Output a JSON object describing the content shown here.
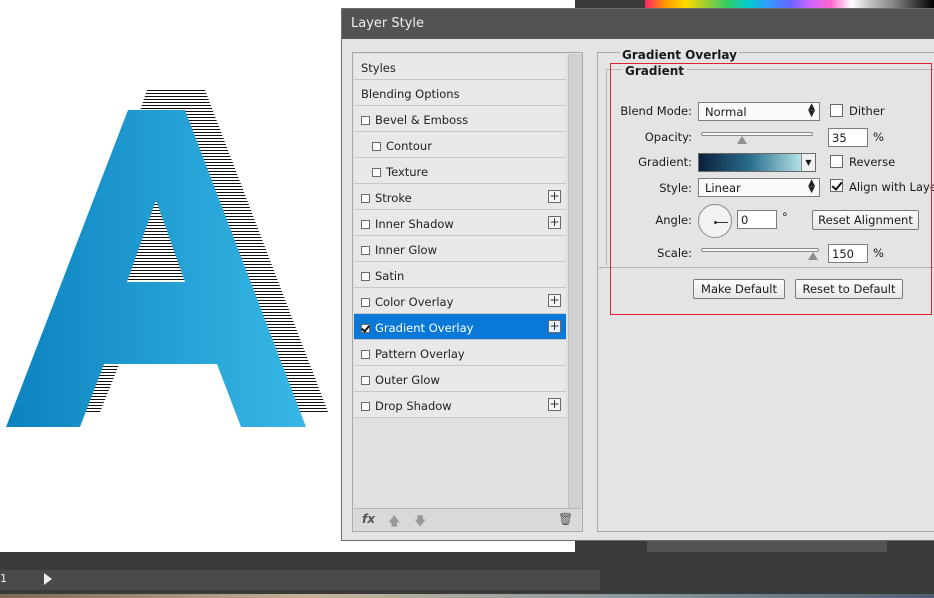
{
  "colors": {
    "accent_selected": "#0a78d7",
    "annotation_red": "#e0202e",
    "letter_gradient_start": "#0c82bf",
    "letter_gradient_end": "#38b8e6"
  },
  "canvas": {
    "letter": "A",
    "status_number": "1"
  },
  "dialog": {
    "title": "Layer Style",
    "styles": [
      {
        "label": "Styles",
        "checkbox": false,
        "plus": false
      },
      {
        "label": "Blending Options",
        "checkbox": false,
        "plus": false
      },
      {
        "label": "Bevel & Emboss",
        "checkbox": true,
        "checked": false,
        "plus": false
      },
      {
        "label": "Contour",
        "checkbox": true,
        "checked": false,
        "plus": false,
        "indent": true
      },
      {
        "label": "Texture",
        "checkbox": true,
        "checked": false,
        "plus": false,
        "indent": true
      },
      {
        "label": "Stroke",
        "checkbox": true,
        "checked": false,
        "plus": true
      },
      {
        "label": "Inner Shadow",
        "checkbox": true,
        "checked": false,
        "plus": true
      },
      {
        "label": "Inner Glow",
        "checkbox": true,
        "checked": false,
        "plus": false
      },
      {
        "label": "Satin",
        "checkbox": true,
        "checked": false,
        "plus": false
      },
      {
        "label": "Color Overlay",
        "checkbox": true,
        "checked": false,
        "plus": true
      },
      {
        "label": "Gradient Overlay",
        "checkbox": true,
        "checked": true,
        "plus": true,
        "selected": true
      },
      {
        "label": "Pattern Overlay",
        "checkbox": true,
        "checked": false,
        "plus": false
      },
      {
        "label": "Outer Glow",
        "checkbox": true,
        "checked": false,
        "plus": false
      },
      {
        "label": "Drop Shadow",
        "checkbox": true,
        "checked": false,
        "plus": true
      }
    ],
    "footer_icons": [
      "fx-icon",
      "move-up-icon",
      "move-down-icon",
      "trash-icon"
    ],
    "fx_label": "fx",
    "panel": {
      "section_title": "Gradient Overlay",
      "group_title": "Gradient",
      "blend_mode": {
        "label": "Blend Mode:",
        "value": "Normal"
      },
      "dither": {
        "label": "Dither",
        "checked": false
      },
      "opacity": {
        "label": "Opacity:",
        "value": "35",
        "unit": "%",
        "slider_fraction": 0.35
      },
      "gradient": {
        "label": "Gradient:",
        "stops": [
          "#0b1f3a",
          "#2b6f8f",
          "#b4e4e6"
        ]
      },
      "reverse": {
        "label": "Reverse",
        "checked": false
      },
      "style": {
        "label": "Style:",
        "value": "Linear"
      },
      "align_with_layer": {
        "label": "Align with Layer",
        "checked": true
      },
      "angle": {
        "label": "Angle:",
        "value": "0",
        "unit": "°"
      },
      "reset_alignment": "Reset Alignment",
      "scale": {
        "label": "Scale:",
        "value": "150",
        "unit": "%",
        "slider_fraction": 1.0
      },
      "make_default": "Make Default",
      "reset_to_default": "Reset to Default"
    }
  },
  "layers_footer_icons": [
    "link-icon",
    "fx-icon",
    "mask-icon",
    "adjustment-icon",
    "folder-icon",
    "new-layer-icon",
    "trash-icon"
  ]
}
